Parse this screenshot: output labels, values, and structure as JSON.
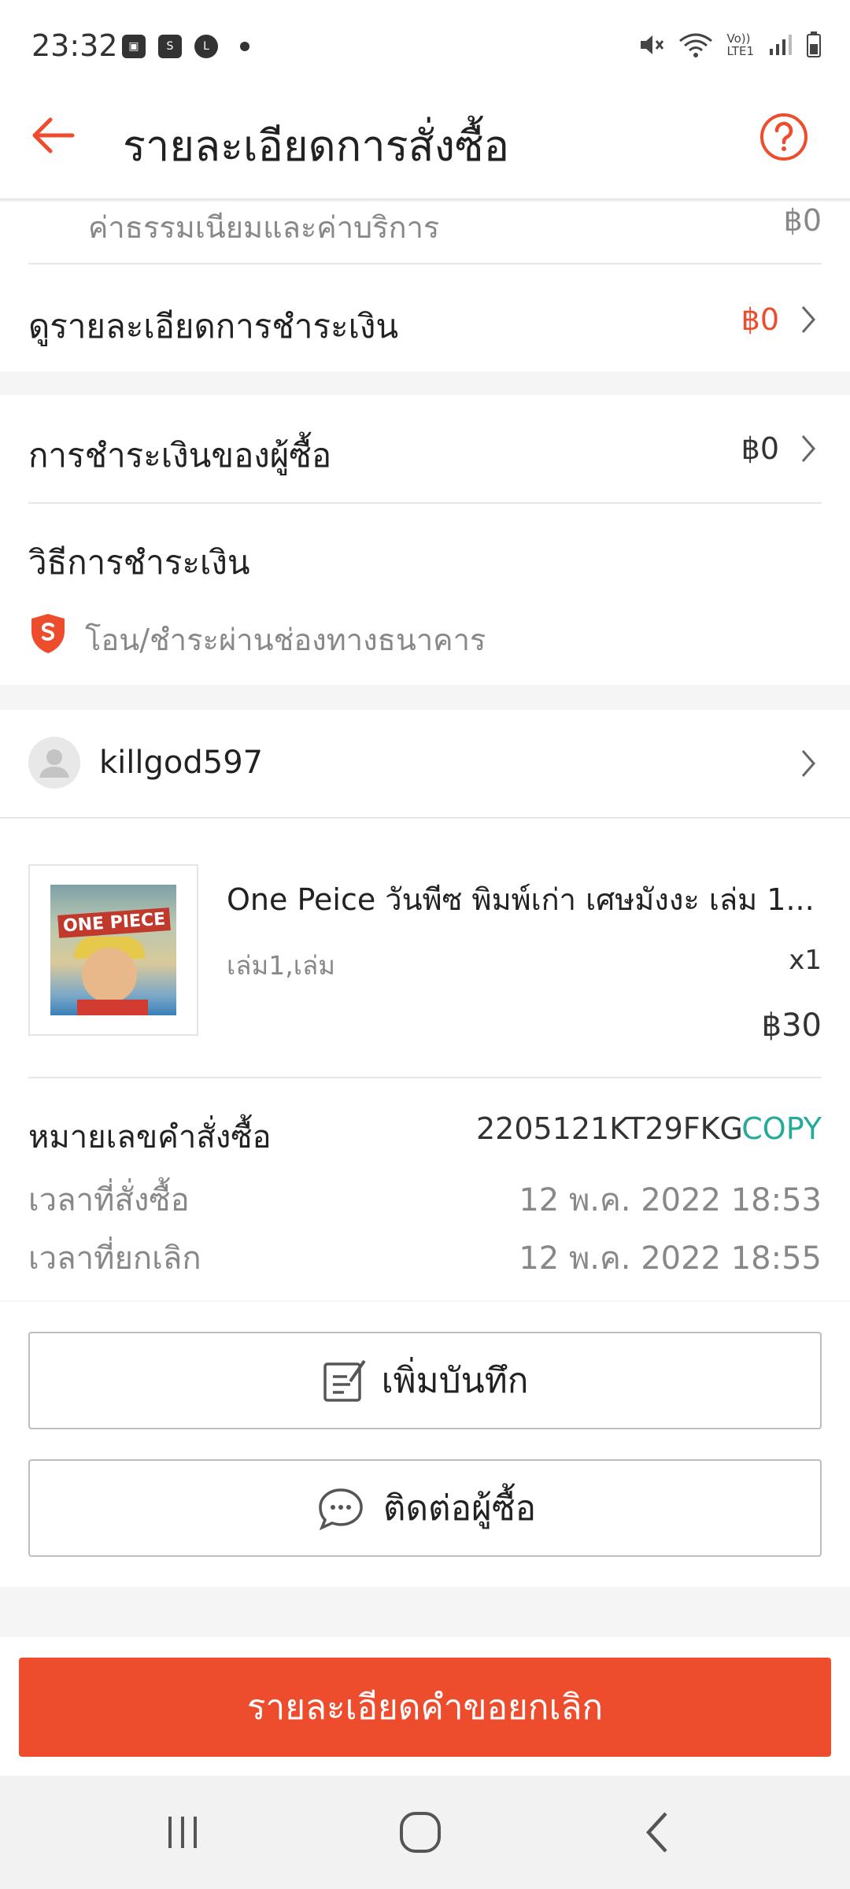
{
  "status_bar": {
    "time": "23:32",
    "volte_label": "Vo))\nLTE1"
  },
  "header": {
    "title": "รายละเอียดการสั่งซื้อ"
  },
  "fees": {
    "label": "ค่าธรรมเนียมและค่าบริการ",
    "value": "฿0"
  },
  "payment_detail": {
    "label": "ดูรายละเอียดการชำระเงิน",
    "value": "฿0"
  },
  "buyer_payment": {
    "label": "การชำระเงินของผู้ซื้อ",
    "value": "฿0"
  },
  "payment_method": {
    "label": "วิธีการชำระเงิน",
    "method": "โอน/ชำระผ่านช่องทางธนาคาร"
  },
  "buyer": {
    "username": "killgod597"
  },
  "product": {
    "name": "One Peice วันพีซ พิมพ์เก่า เศษมังงะ เล่ม 1...",
    "variation": "เล่ม1,เล่ม",
    "quantity": "x1",
    "price": "฿30",
    "cover_title": "ONE PIECE"
  },
  "order": {
    "number_label": "หมายเลขคำสั่งซื้อ",
    "number_value": "2205121KT29FKG",
    "copy_label": "COPY",
    "order_time_label": "เวลาที่สั่งซื้อ",
    "order_time_value": "12 พ.ค. 2022 18:53",
    "cancel_time_label": "เวลาที่ยกเลิก",
    "cancel_time_value": "12 พ.ค. 2022 18:55"
  },
  "actions": {
    "add_note": "เพิ่มบันทึก",
    "contact_buyer": "ติดต่อผู้ซื้อ",
    "cancel_details": "รายละเอียดคำขอยกเลิก"
  },
  "colors": {
    "brand": "#ee4d2d",
    "teal": "#26aa99"
  }
}
